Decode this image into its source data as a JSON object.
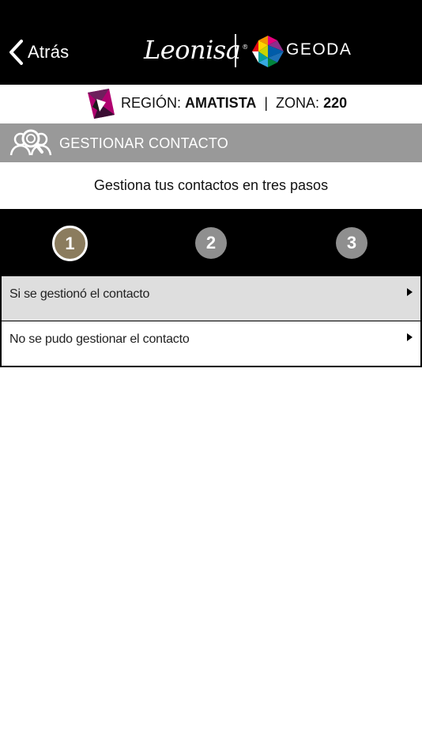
{
  "nav": {
    "back_label": "Atrás",
    "brand_primary": "Leonisa",
    "brand_registered": "®",
    "brand_secondary": "GEODA"
  },
  "region": {
    "region_label": "REGIÓN:",
    "region_value": "AMATISTA",
    "separator": "|",
    "zone_label": "ZONA:",
    "zone_value": "220"
  },
  "section": {
    "title": "GESTIONAR CONTACTO",
    "icon": "people-search-icon"
  },
  "subtitle": "Gestiona tus contactos en tres pasos",
  "steps": [
    {
      "label": "1",
      "active": true
    },
    {
      "label": "2",
      "active": false
    },
    {
      "label": "3",
      "active": false
    }
  ],
  "options": [
    {
      "label": "Si se gestionó el contacto"
    },
    {
      "label": "No se pudo gestionar el contacto"
    }
  ],
  "colors": {
    "nav_background": "#000000",
    "section_background": "#999999",
    "active_step": "#8b7c5e",
    "inactive_step": "#8f8f8f",
    "selected_option": "#dedede"
  }
}
